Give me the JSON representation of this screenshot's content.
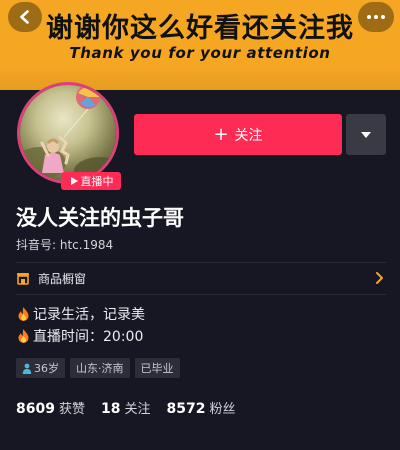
{
  "banner": {
    "title": "谢谢你这么好看还关注我",
    "subtitle": "Thank you for your attention"
  },
  "profile": {
    "live_badge": "直播中",
    "nickname": "没人关注的虫子哥",
    "douyin_id": "抖音号: htc.1984"
  },
  "actions": {
    "follow_label": "关注"
  },
  "shop": {
    "label": "商品橱窗"
  },
  "bio": {
    "line1": "记录生活，记录美",
    "line2": "直播时间：20:00"
  },
  "tags": {
    "age": "36岁",
    "location": "山东·济南",
    "education": "已毕业"
  },
  "stats": {
    "likes_count": "8609",
    "likes_label": "获赞",
    "following_count": "18",
    "following_label": "关注",
    "followers_count": "8572",
    "followers_label": "粉丝"
  },
  "colors": {
    "banner": "#f5a623",
    "follow_button": "#fe2c55",
    "live_ring": "#d9417a",
    "background": "#161722",
    "shop_icon": "#f5a623"
  },
  "icons": {
    "back": "chevron-left-icon",
    "more": "more-dots-icon",
    "play": "play-icon",
    "dropdown": "triangle-down-icon",
    "shop": "shop-icon",
    "chevron": "chevron-right-icon",
    "fire": "fire-icon",
    "person": "person-icon"
  }
}
